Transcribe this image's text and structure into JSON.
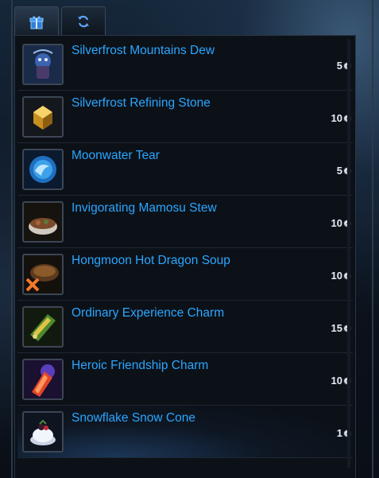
{
  "tabs": [
    {
      "id": "gift",
      "icon": "gift-icon",
      "active": true
    },
    {
      "id": "exchange",
      "icon": "refresh-icon",
      "active": false
    }
  ],
  "items": [
    {
      "name": "Silverfrost Mountains Dew",
      "price": "5",
      "icon": "dew-icon"
    },
    {
      "name": "Silverfrost Refining Stone",
      "price": "10",
      "icon": "refining-stone-icon"
    },
    {
      "name": "Moonwater Tear",
      "price": "5",
      "icon": "moonwater-tear-icon"
    },
    {
      "name": "Invigorating Mamosu Stew",
      "price": "10",
      "icon": "stew-icon"
    },
    {
      "name": "Hongmoon Hot Dragon Soup",
      "price": "10",
      "icon": "dragon-soup-icon"
    },
    {
      "name": "Ordinary Experience Charm",
      "price": "15",
      "icon": "experience-charm-icon"
    },
    {
      "name": "Heroic Friendship Charm",
      "price": "10",
      "icon": "friendship-charm-icon"
    },
    {
      "name": "Snowflake Snow Cone",
      "price": "1",
      "icon": "snow-cone-icon",
      "selected": true
    }
  ],
  "colors": {
    "item_name": "#2aa6ff",
    "price": "#e8eef5"
  }
}
